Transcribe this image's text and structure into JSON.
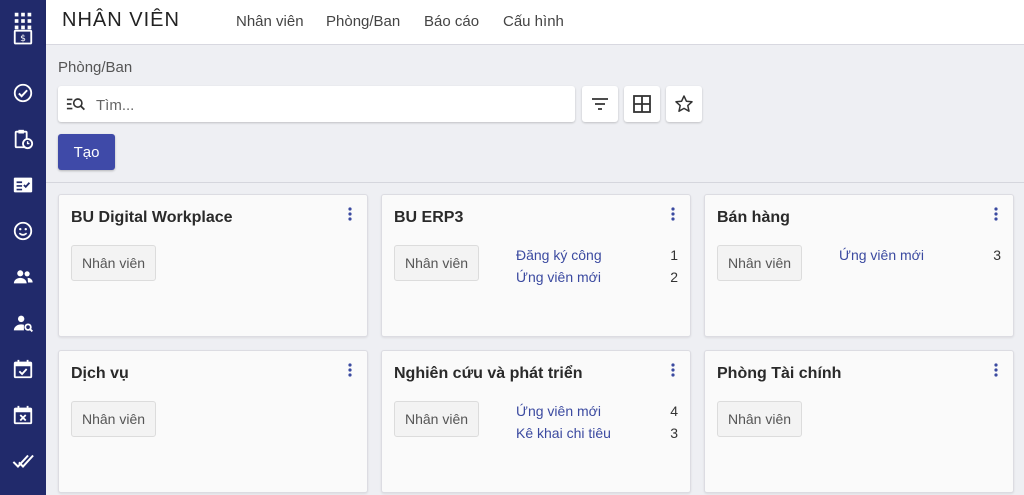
{
  "topbar": {
    "app_title": "NHÂN VIÊN",
    "menu": [
      {
        "label": "Nhân viên"
      },
      {
        "label": "Phòng/Ban"
      },
      {
        "label": "Báo cáo"
      },
      {
        "label": "Cấu hình"
      }
    ]
  },
  "sidebar": {
    "items": [
      {
        "icon": "apps-grid-icon"
      },
      {
        "icon": "payroll-icon"
      },
      {
        "icon": "check-circle-icon"
      },
      {
        "icon": "clipboard-clock-icon"
      },
      {
        "icon": "checklist-icon"
      },
      {
        "icon": "smiley-icon"
      },
      {
        "icon": "people-icon"
      },
      {
        "icon": "person-search-icon"
      },
      {
        "icon": "calendar-check-icon"
      },
      {
        "icon": "calendar-x-icon"
      },
      {
        "icon": "double-check-icon"
      }
    ]
  },
  "control_panel": {
    "breadcrumb": "Phòng/Ban",
    "search_placeholder": "Tìm...",
    "create_label": "Tạo",
    "tools": [
      "filter-icon",
      "group-by-icon",
      "favorite-star-icon"
    ]
  },
  "cards": [
    {
      "title": "BU Digital Workplace",
      "button": "Nhân viên",
      "stats": []
    },
    {
      "title": "BU ERP3",
      "button": "Nhân viên",
      "stats": [
        {
          "label": "Đăng ký công",
          "count": "1"
        },
        {
          "label": "Ứng viên mới",
          "count": "2"
        }
      ]
    },
    {
      "title": "Bán hàng",
      "button": "Nhân viên",
      "stats": [
        {
          "label": "Ứng viên mới",
          "count": "3"
        }
      ]
    },
    {
      "title": "Dịch vụ",
      "button": "Nhân viên",
      "stats": []
    },
    {
      "title": "Nghiên cứu và phát triển",
      "button": "Nhân viên",
      "stats": [
        {
          "label": "Ứng viên mới",
          "count": "4"
        },
        {
          "label": "Kê khai chi tiêu",
          "count": "3"
        }
      ]
    },
    {
      "title": "Phòng Tài chính",
      "button": "Nhân viên",
      "stats": []
    }
  ],
  "colors": {
    "sidebar_bg": "#212a6b",
    "primary_button": "#3f4aa8",
    "link_text": "#3b4aa0"
  }
}
